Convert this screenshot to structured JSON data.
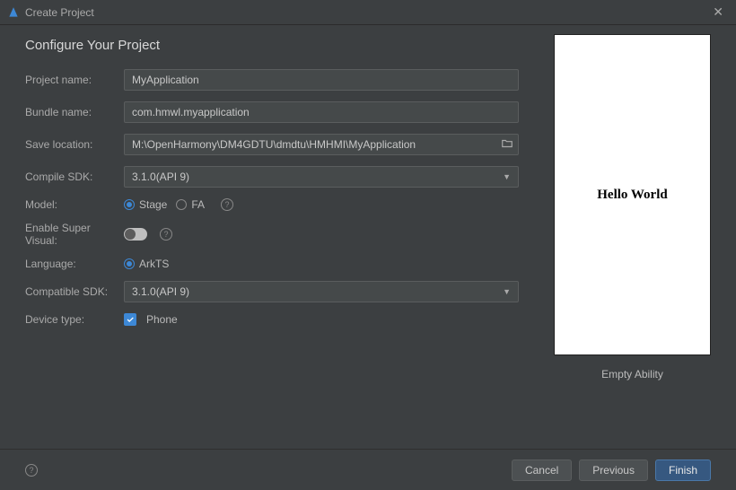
{
  "titlebar": {
    "title": "Create Project"
  },
  "heading": "Configure Your Project",
  "labels": {
    "project_name": "Project name:",
    "bundle_name": "Bundle name:",
    "save_location": "Save location:",
    "compile_sdk": "Compile SDK:",
    "model": "Model:",
    "enable_super_visual": "Enable Super Visual:",
    "language": "Language:",
    "compatible_sdk": "Compatible SDK:",
    "device_type": "Device type:"
  },
  "values": {
    "project_name": "MyApplication",
    "bundle_name": "com.hmwl.myapplication",
    "save_location": "M:\\OpenHarmony\\DM4GDTU\\dmdtu\\HMHMI\\MyApplication",
    "compile_sdk": "3.1.0(API 9)",
    "compatible_sdk": "3.1.0(API 9)"
  },
  "model": {
    "stage": "Stage",
    "fa": "FA",
    "selected": "Stage"
  },
  "language": {
    "arkts": "ArkTS",
    "selected": "ArkTS"
  },
  "device_type": {
    "phone": "Phone",
    "phone_checked": true
  },
  "preview": {
    "hello": "Hello World",
    "caption": "Empty Ability"
  },
  "buttons": {
    "cancel": "Cancel",
    "previous": "Previous",
    "finish": "Finish"
  }
}
